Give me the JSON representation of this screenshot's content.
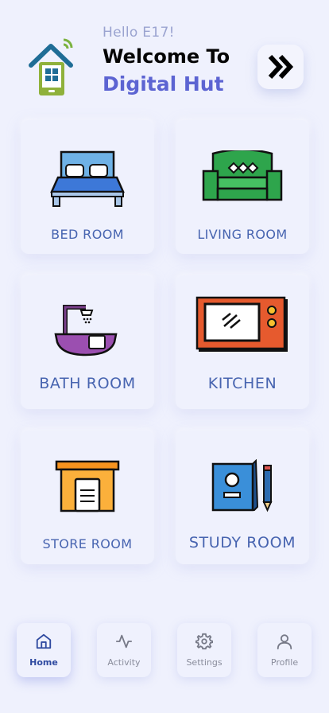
{
  "header": {
    "greeting": "Hello E17!",
    "welcome": "Welcome To",
    "brand": "Digital Hut",
    "next_icon": "double-chevron-right-icon"
  },
  "rooms": [
    {
      "label": "BED ROOM",
      "icon": "bed-icon"
    },
    {
      "label": "LIVING ROOM",
      "icon": "sofa-icon"
    },
    {
      "label": "BATH ROOM",
      "icon": "bathtub-icon"
    },
    {
      "label": "KITCHEN",
      "icon": "microwave-icon"
    },
    {
      "label": "STORE ROOM",
      "icon": "storage-icon"
    },
    {
      "label": "STUDY ROOM",
      "icon": "book-icon"
    }
  ],
  "nav": [
    {
      "label": "Home",
      "icon": "home-icon",
      "active": true
    },
    {
      "label": "Activity",
      "icon": "activity-icon",
      "active": false
    },
    {
      "label": "Settings",
      "icon": "gear-icon",
      "active": false
    },
    {
      "label": "Profile",
      "icon": "user-icon",
      "active": false
    }
  ]
}
